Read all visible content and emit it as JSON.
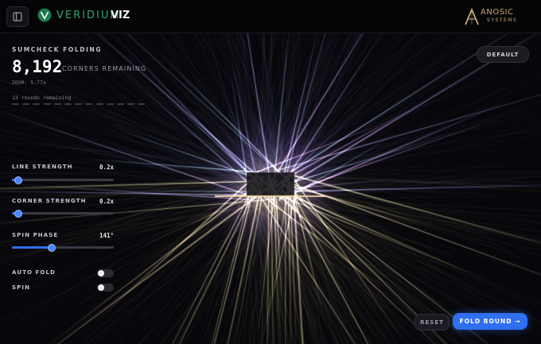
{
  "header": {
    "menu_icon": "sidebar-toggle-icon",
    "brand_icon": "veridium-v-logo",
    "brand_name": "VERIDIUM",
    "brand_suffix": "VIZ",
    "partner_icon": "anosic-a-logo",
    "partner_name": "ANOSIC",
    "partner_sub": "SYSTEMS"
  },
  "panel": {
    "eyebrow": "SUMCHECK FOLDING",
    "count": "8,192",
    "count_label": "CORNERS REMAINING",
    "zoom": "ZOOM: 5.77x",
    "rounds_text": "13 rounds remaining",
    "rounds_total": 13,
    "rounds_done": 0
  },
  "default_button": "DEFAULT",
  "sliders": [
    {
      "label": "LINE STRENGTH",
      "value_text": "0.2x",
      "fraction": 0.06
    },
    {
      "label": "CORNER STRENGTH",
      "value_text": "0.2x",
      "fraction": 0.06
    },
    {
      "label": "SPIN PHASE",
      "value_text": "141°",
      "fraction": 0.39
    }
  ],
  "toggles": [
    {
      "label": "AUTO FOLD",
      "on": false
    },
    {
      "label": "SPIN",
      "on": false
    }
  ],
  "actions": {
    "reset": "RESET",
    "fold": "FOLD ROUND →"
  },
  "colors": {
    "accent": "#2f6ff0",
    "brand_green": "#2fa36b",
    "partner_gold": "#c8a873"
  }
}
